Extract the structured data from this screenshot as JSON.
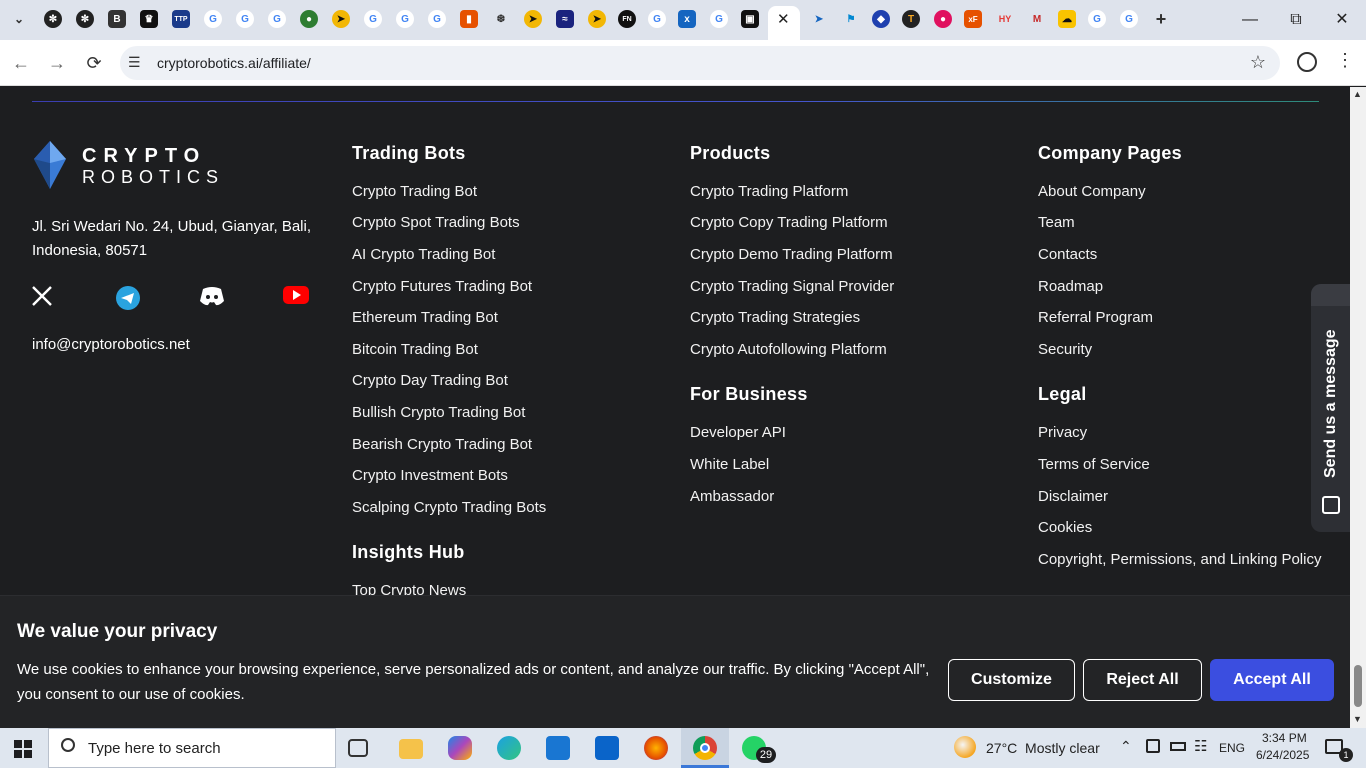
{
  "browser": {
    "url": "cryptorobotics.ai/affiliate/",
    "colors": {
      "tabbar": "#dee3ec",
      "accent": "#3b4ee0"
    }
  },
  "footer": {
    "logo_line1": "CRYPTO",
    "logo_line2": "ROBOTICS",
    "address": "Jl. Sri Wedari No. 24, Ubud, Gianyar, Bali, Indonesia, 80571",
    "email": "info@cryptorobotics.net",
    "social_icons": [
      "x-icon",
      "telegram-icon",
      "discord-icon",
      "youtube-icon"
    ],
    "trading_bots": {
      "heading": "Trading Bots",
      "links": [
        "Crypto Trading Bot",
        "Crypto Spot Trading Bots",
        "AI Crypto Trading Bot",
        "Crypto Futures Trading Bot",
        "Ethereum Trading Bot",
        "Bitcoin Trading Bot",
        "Crypto Day Trading Bot",
        "Bullish Crypto Trading Bot",
        "Bearish Crypto Trading Bot",
        "Crypto Investment Bots",
        "Scalping Crypto Trading Bots"
      ]
    },
    "insights": {
      "heading": "Insights Hub",
      "links": [
        "Top Crypto News"
      ]
    },
    "products": {
      "heading": "Products",
      "links": [
        "Crypto Trading Platform",
        "Crypto Copy Trading Platform",
        "Crypto Demo Trading Platform",
        "Crypto Trading Signal Provider",
        "Crypto Trading Strategies",
        "Crypto Autofollowing Platform"
      ]
    },
    "business": {
      "heading": "For Business",
      "links": [
        "Developer API",
        "White Label",
        "Ambassador"
      ]
    },
    "company": {
      "heading": "Company Pages",
      "links": [
        "About Company",
        "Team",
        "Contacts",
        "Roadmap",
        "Referral Program",
        "Security"
      ]
    },
    "legal": {
      "heading": "Legal",
      "links": [
        "Privacy",
        "Terms of Service",
        "Disclaimer",
        "Cookies",
        "Copyright, Permissions, and Linking Policy"
      ]
    }
  },
  "jivo": {
    "label": "Send us a message"
  },
  "cookie": {
    "title": "We value your privacy",
    "text": "We use cookies to enhance your browsing experience, serve personalized ads or content, and analyze our traffic. By clicking \"Accept All\", you consent to our use of cookies.",
    "customize": "Customize",
    "reject": "Reject All",
    "accept": "Accept All"
  },
  "taskbar": {
    "search_placeholder": "Type here to search",
    "weather": "27°C  Mostly clear",
    "language": "ENG",
    "time": "3:34 PM",
    "date": "6/24/2025",
    "whatsapp_badge": "29",
    "notification_count": "1"
  }
}
